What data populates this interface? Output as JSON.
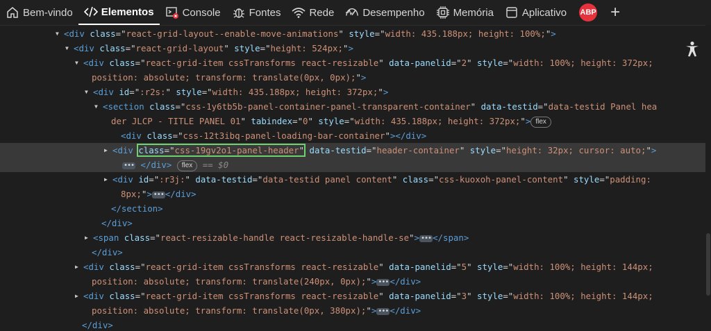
{
  "tabs": [
    {
      "name": "tab-bem-vindo",
      "icon": "home-icon",
      "label": "Bem-vindo",
      "active": false
    },
    {
      "name": "tab-elementos",
      "icon": "code-icon",
      "label": "Elementos",
      "active": true
    },
    {
      "name": "tab-console",
      "icon": "console-icon",
      "label": "Console",
      "active": false
    },
    {
      "name": "tab-fontes",
      "icon": "bug-icon",
      "label": "Fontes",
      "active": false
    },
    {
      "name": "tab-rede",
      "icon": "wifi-icon",
      "label": "Rede",
      "active": false
    },
    {
      "name": "tab-desempenho",
      "icon": "performance-icon",
      "label": "Desempenho",
      "active": false
    },
    {
      "name": "tab-memoria",
      "icon": "memory-chip-icon",
      "label": "Memória",
      "active": false
    },
    {
      "name": "tab-aplicativo",
      "icon": "application-icon",
      "label": "Aplicativo",
      "active": false
    }
  ],
  "extension": {
    "label": "ABP",
    "color": "#e5323c"
  },
  "add_tab": {
    "label": "+"
  },
  "colors": {
    "tag": "#5c9fd8",
    "attr": "#9cdcfe",
    "value": "#ce9178",
    "selection_outline": "#6dd26d"
  },
  "lines": [
    {
      "indent": 92,
      "tri": "▼",
      "parts": [
        [
          "tag",
          "<div "
        ],
        [
          "attr",
          "class"
        ],
        [
          "txt",
          "=\""
        ],
        [
          "val",
          "react-grid-layout--enable-move-animations"
        ],
        [
          "txt",
          "\" "
        ],
        [
          "attr",
          "style"
        ],
        [
          "txt",
          "=\""
        ],
        [
          "val",
          "width: 435.188px; height: 100%;"
        ],
        [
          "txt",
          "\""
        ],
        [
          "tag",
          ">"
        ]
      ]
    },
    {
      "indent": 106,
      "tri": "▼",
      "parts": [
        [
          "tag",
          "<div "
        ],
        [
          "attr",
          "class"
        ],
        [
          "txt",
          "=\""
        ],
        [
          "val",
          "react-grid-layout"
        ],
        [
          "txt",
          "\" "
        ],
        [
          "attr",
          "style"
        ],
        [
          "txt",
          "=\""
        ],
        [
          "val",
          "height: 524px;"
        ],
        [
          "txt",
          "\""
        ],
        [
          "tag",
          ">"
        ]
      ]
    },
    {
      "indent": 120,
      "tri": "▼",
      "parts": [
        [
          "tag",
          "<div "
        ],
        [
          "attr",
          "class"
        ],
        [
          "txt",
          "=\""
        ],
        [
          "val",
          "react-grid-item cssTransforms react-resizable"
        ],
        [
          "txt",
          "\" "
        ],
        [
          "attr",
          "data-panelid"
        ],
        [
          "txt",
          "=\""
        ],
        [
          "val",
          "2"
        ],
        [
          "txt",
          "\" "
        ],
        [
          "attr",
          "style"
        ],
        [
          "txt",
          "=\""
        ],
        [
          "val",
          "width: 100%; height: 372px;"
        ]
      ]
    },
    {
      "indent": 132,
      "tri": "",
      "parts": [
        [
          "val",
          "position: absolute; transform: translate(0px, 0px);"
        ],
        [
          "txt",
          "\""
        ],
        [
          "tag",
          ">"
        ]
      ]
    },
    {
      "indent": 134,
      "tri": "▼",
      "parts": [
        [
          "tag",
          "<div "
        ],
        [
          "attr",
          "id"
        ],
        [
          "txt",
          "=\""
        ],
        [
          "val",
          ":r2s:"
        ],
        [
          "txt",
          "\" "
        ],
        [
          "attr",
          "style"
        ],
        [
          "txt",
          "=\""
        ],
        [
          "val",
          "width: 435.188px; height: 372px;"
        ],
        [
          "txt",
          "\""
        ],
        [
          "tag",
          ">"
        ]
      ]
    },
    {
      "indent": 148,
      "tri": "▼",
      "parts": [
        [
          "tag",
          "<section "
        ],
        [
          "attr",
          "class"
        ],
        [
          "txt",
          "=\""
        ],
        [
          "val",
          "css-1y6tb5b-panel-container-panel-transparent-container"
        ],
        [
          "txt",
          "\" "
        ],
        [
          "attr",
          "data-testid"
        ],
        [
          "txt",
          "=\""
        ],
        [
          "val",
          "data-testid Panel hea"
        ]
      ]
    },
    {
      "indent": 160,
      "tri": "",
      "parts": [
        [
          "val",
          "der JLCP - TITLE PANEL 01"
        ],
        [
          "txt",
          "\" "
        ],
        [
          "attr",
          "tabindex"
        ],
        [
          "txt",
          "=\""
        ],
        [
          "val",
          "0"
        ],
        [
          "txt",
          "\" "
        ],
        [
          "attr",
          "style"
        ],
        [
          "txt",
          "=\""
        ],
        [
          "val",
          "width: 435.188px; height: 372px;"
        ],
        [
          "txt",
          "\""
        ],
        [
          "tag",
          ">"
        ],
        [
          "badge",
          "flex"
        ]
      ]
    },
    {
      "indent": 174,
      "tri": "",
      "parts": [
        [
          "tag",
          "<div "
        ],
        [
          "attr",
          "class"
        ],
        [
          "txt",
          "=\""
        ],
        [
          "val",
          "css-12t3ibq-panel-loading-bar-container"
        ],
        [
          "txt",
          "\""
        ],
        [
          "tag",
          "></div>"
        ]
      ]
    },
    {
      "indent": 162,
      "tri": "▶",
      "sel": true,
      "parts": [
        [
          "tag",
          "<div "
        ],
        [
          "hl_start",
          ""
        ],
        [
          "attr",
          "class"
        ],
        [
          "txt",
          "=\""
        ],
        [
          "val",
          "css-19gv2o1-panel-header"
        ],
        [
          "txt",
          "\""
        ],
        [
          "hl_end",
          ""
        ],
        [
          "txt",
          " "
        ],
        [
          "attr",
          "data-testid"
        ],
        [
          "txt",
          "=\""
        ],
        [
          "val",
          "header-container"
        ],
        [
          "txt",
          "\" "
        ],
        [
          "attr",
          "style"
        ],
        [
          "txt",
          "=\""
        ],
        [
          "val",
          "height: 32px; cursor: auto;"
        ],
        [
          "txt",
          "\""
        ],
        [
          "tag",
          ">"
        ]
      ]
    },
    {
      "indent": 176,
      "tri": "",
      "sel": true,
      "parts": [
        [
          "ell",
          "•••"
        ],
        [
          "tag",
          " </div>"
        ],
        [
          "txt",
          " "
        ],
        [
          "badge",
          "flex"
        ],
        [
          "note",
          " == $0"
        ]
      ]
    },
    {
      "indent": 162,
      "tri": "▶",
      "parts": [
        [
          "tag",
          "<div "
        ],
        [
          "attr",
          "id"
        ],
        [
          "txt",
          "=\""
        ],
        [
          "val",
          ":r3j:"
        ],
        [
          "txt",
          "\" "
        ],
        [
          "attr",
          "data-testid"
        ],
        [
          "txt",
          "=\""
        ],
        [
          "val",
          "data-testid panel content"
        ],
        [
          "txt",
          "\" "
        ],
        [
          "attr",
          "class"
        ],
        [
          "txt",
          "=\""
        ],
        [
          "val",
          "css-kuoxoh-panel-content"
        ],
        [
          "txt",
          "\" "
        ],
        [
          "attr",
          "style"
        ],
        [
          "txt",
          "=\""
        ],
        [
          "val",
          "padding:"
        ]
      ]
    },
    {
      "indent": 174,
      "tri": "",
      "parts": [
        [
          "val",
          "8px;"
        ],
        [
          "txt",
          "\""
        ],
        [
          "tag",
          ">"
        ],
        [
          "ell",
          "•••"
        ],
        [
          "tag",
          "</div>"
        ]
      ]
    },
    {
      "indent": 160,
      "tri": "",
      "parts": [
        [
          "tag",
          "</section>"
        ]
      ]
    },
    {
      "indent": 146,
      "tri": "",
      "parts": [
        [
          "tag",
          "</div>"
        ]
      ]
    },
    {
      "indent": 134,
      "tri": "▶",
      "parts": [
        [
          "tag",
          "<span "
        ],
        [
          "attr",
          "class"
        ],
        [
          "txt",
          "=\""
        ],
        [
          "val",
          "react-resizable-handle react-resizable-handle-se"
        ],
        [
          "txt",
          "\""
        ],
        [
          "tag",
          ">"
        ],
        [
          "ell",
          "•••"
        ],
        [
          "tag",
          "</span>"
        ]
      ]
    },
    {
      "indent": 132,
      "tri": "",
      "parts": [
        [
          "tag",
          "</div>"
        ]
      ]
    },
    {
      "indent": 120,
      "tri": "▶",
      "parts": [
        [
          "tag",
          "<div "
        ],
        [
          "attr",
          "class"
        ],
        [
          "txt",
          "=\""
        ],
        [
          "val",
          "react-grid-item cssTransforms react-resizable"
        ],
        [
          "txt",
          "\" "
        ],
        [
          "attr",
          "data-panelid"
        ],
        [
          "txt",
          "=\""
        ],
        [
          "val",
          "5"
        ],
        [
          "txt",
          "\" "
        ],
        [
          "attr",
          "style"
        ],
        [
          "txt",
          "=\""
        ],
        [
          "val",
          "width: 100%; height: 144px;"
        ]
      ]
    },
    {
      "indent": 132,
      "tri": "",
      "parts": [
        [
          "val",
          "position: absolute; transform: translate(240px, 0px);"
        ],
        [
          "txt",
          "\""
        ],
        [
          "tag",
          ">"
        ],
        [
          "ell",
          "•••"
        ],
        [
          "tag",
          "</div>"
        ]
      ]
    },
    {
      "indent": 120,
      "tri": "▶",
      "parts": [
        [
          "tag",
          "<div "
        ],
        [
          "attr",
          "class"
        ],
        [
          "txt",
          "=\""
        ],
        [
          "val",
          "react-grid-item cssTransforms react-resizable"
        ],
        [
          "txt",
          "\" "
        ],
        [
          "attr",
          "data-panelid"
        ],
        [
          "txt",
          "=\""
        ],
        [
          "val",
          "3"
        ],
        [
          "txt",
          "\" "
        ],
        [
          "attr",
          "style"
        ],
        [
          "txt",
          "=\""
        ],
        [
          "val",
          "width: 100%; height: 144px;"
        ]
      ]
    },
    {
      "indent": 132,
      "tri": "",
      "parts": [
        [
          "val",
          "position: absolute; transform: translate(0px, 380px);"
        ],
        [
          "txt",
          "\""
        ],
        [
          "tag",
          ">"
        ],
        [
          "ell",
          "•••"
        ],
        [
          "tag",
          "</div>"
        ]
      ]
    },
    {
      "indent": 118,
      "tri": "",
      "parts": [
        [
          "tag",
          "</div>"
        ]
      ]
    },
    {
      "indent": 118,
      "tri": "",
      "parts": [
        [
          "txt",
          "..."
        ]
      ]
    }
  ]
}
